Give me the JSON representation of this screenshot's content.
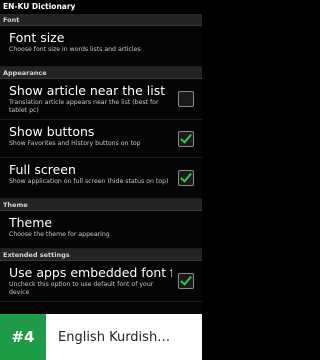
{
  "status_bar": {
    "title": "EN-KU Dictionary"
  },
  "sections": {
    "font": {
      "header": "Font"
    },
    "appearance": {
      "header": "Appearance"
    },
    "theme": {
      "header": "Theme"
    },
    "extended": {
      "header": "Extended settings"
    }
  },
  "prefs": {
    "font_size": {
      "title": "Font size",
      "summary": "Choose font size in words lists and articles"
    },
    "show_article": {
      "title": "Show article near the list",
      "summary": "Translation article appears near the list (best for tablet pc)",
      "checked": false
    },
    "show_buttons": {
      "title": "Show buttons",
      "summary": "Show Favorites and History buttons on top",
      "checked": true
    },
    "full_screen": {
      "title": "Full screen",
      "summary": "Show application on full screen (hide status on top)",
      "checked": true
    },
    "theme": {
      "title": "Theme",
      "summary": "Choose the theme for appearing"
    },
    "embedded_font": {
      "title": "Use apps embedded font for s",
      "summary": "Uncheck this option to use default font of your device",
      "checked": true
    }
  },
  "banner": {
    "rank": "#4",
    "app_name": "English Kurdish…"
  },
  "colors": {
    "check_green": "#2ec94a",
    "badge_green": "#1e9b47"
  }
}
